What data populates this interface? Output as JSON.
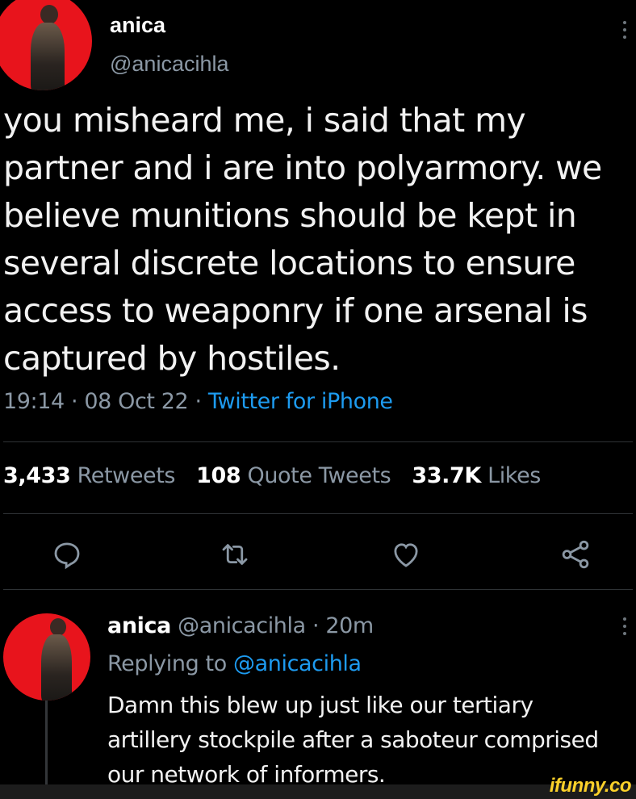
{
  "tweet": {
    "display_name": "anica",
    "handle": "@anicacihla",
    "text": "you misheard me, i said that my\npartner and i are into polyarmory. we\nbelieve munitions should be kept in\nseveral discrete locations to ensure\naccess to weaponry if one arsenal is\ncaptured by hostiles.",
    "time": "19:14",
    "date": "08 Oct 22",
    "source": "Twitter for iPhone",
    "separator": " · "
  },
  "stats": {
    "retweets_count": "3,433",
    "retweets_label": "Retweets",
    "quotes_count": "108",
    "quotes_label": "Quote Tweets",
    "likes_count": "33.7K",
    "likes_label": "Likes"
  },
  "actions": {
    "icons": [
      "reply-icon",
      "retweet-icon",
      "like-icon",
      "share-icon"
    ]
  },
  "reply": {
    "display_name": "anica",
    "handle": "@anicacihla",
    "age": "20m",
    "replying_prefix": "Replying to",
    "replying_to": "@anicacihla",
    "text": "Damn this blew up just like our tertiary\nartillery stockpile after a saboteur comprised\nour network of informers."
  },
  "watermark": "ifunny.co",
  "colors": {
    "background": "#000000",
    "link": "#1d9bf0",
    "secondary_text": "#8b98a5",
    "avatar_bg": "#e8141c"
  }
}
